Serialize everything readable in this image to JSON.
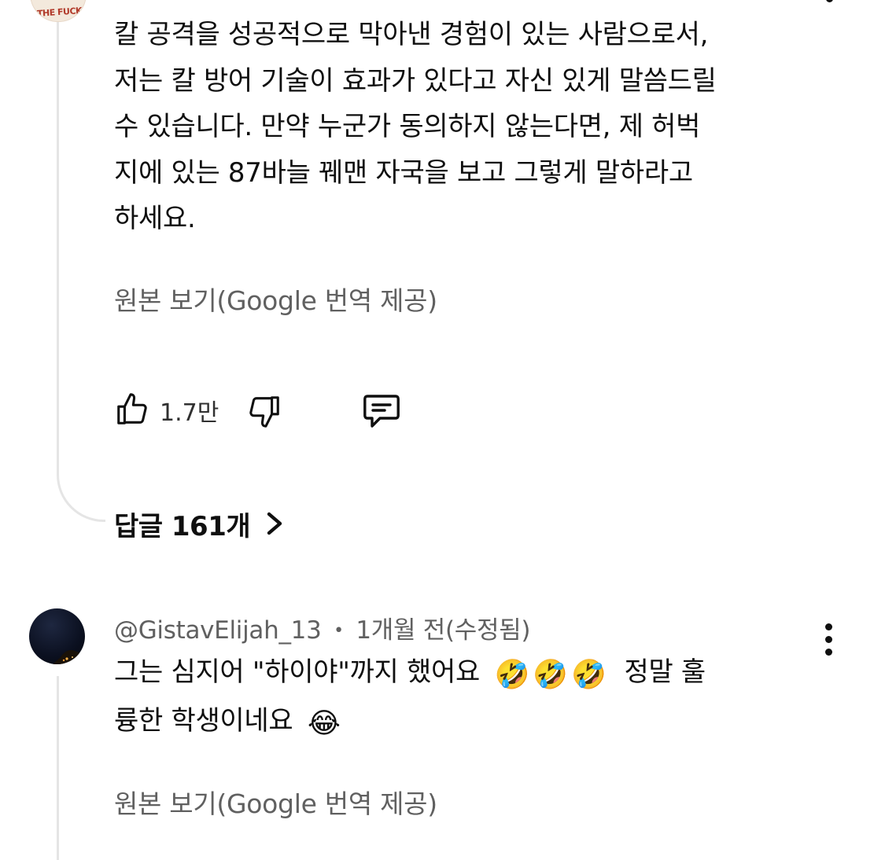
{
  "comment1": {
    "avatar_text": "THE FUCK",
    "body_lines": [
      "칼 공격을 성공적으로 막아낸 경험이 있는 사람으로서,",
      "저는 칼 방어 기술이 효과가 있다고 자신 있게 말씀드릴",
      "수 있습니다. 만약 누군가 동의하지 않는다면, 제 허벅",
      "지에 있는 87바늘 꿰맨 자국을 보고 그렇게 말하라고",
      "하세요."
    ],
    "translate_link": "원본 보기(Google 번역 제공)",
    "like_count": "1.7만",
    "replies_label": "답글 161개"
  },
  "comment2": {
    "author": "@GistavElijah_13",
    "separator": "•",
    "time": "1개월 전(수정됨)",
    "body_line1_text": "그는 심지어 \"하이야\"까지 했어요",
    "body_line1_emojis": "🤣🤣🤣",
    "body_line1_after": "정말 훌",
    "body_line2_text": "륭한 학생이네요",
    "body_line2_emoji": "😂",
    "translate_link": "원본 보기(Google 번역 제공)"
  },
  "colors": {
    "text_primary": "#0f0f0f",
    "text_secondary": "#606060",
    "thread_line": "#e5e5e5"
  }
}
